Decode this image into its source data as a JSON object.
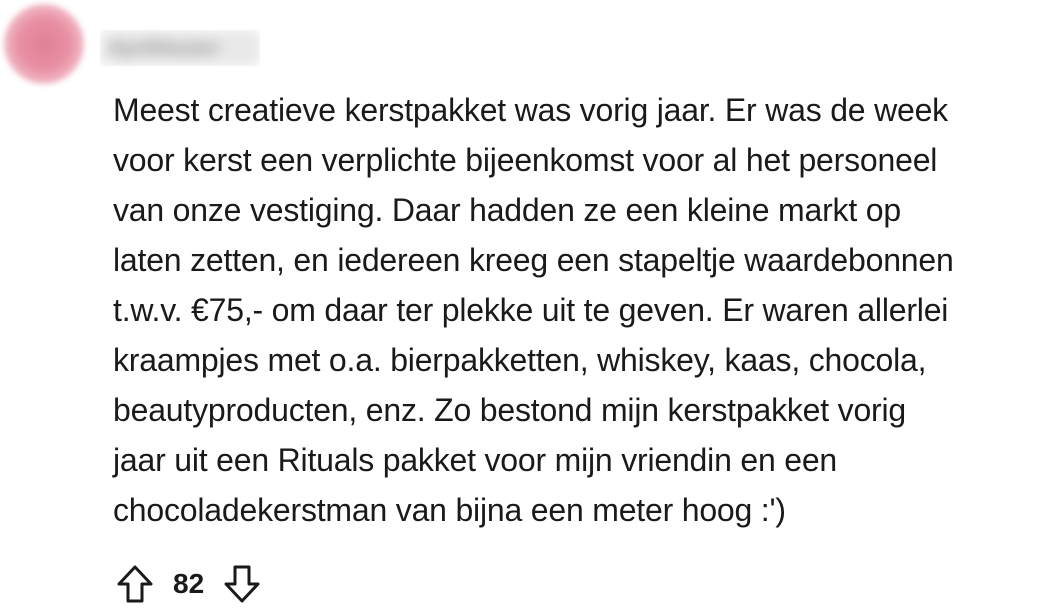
{
  "comment": {
    "author": "AprilMaster",
    "body_lines": [
      "Meest creatieve kerstpakket was vorig jaar. Er was de week",
      "voor kerst een verplichte bijeenkomst voor al het personeel",
      "van onze vestiging. Daar hadden ze een kleine markt op",
      "laten zetten, en iedereen kreeg een stapeltje waardebonnen",
      "t.w.v. €75,- om daar ter plekke uit te geven. Er waren allerlei",
      "kraampjes met o.a. bierpakketten, whiskey, kaas, chocola,",
      "beautyproducten, enz. Zo bestond mijn kerstpakket vorig",
      "jaar uit een Rituals pakket voor mijn vriendin en een",
      "chocoladekerstman van bijna een meter hoog :')"
    ],
    "vote_count": "82"
  },
  "icons": {
    "upvote": "arrow-up-outline-icon",
    "downvote": "arrow-down-outline-icon"
  },
  "colors": {
    "text": "#1a1a1b",
    "avatar": "#e890a4"
  }
}
